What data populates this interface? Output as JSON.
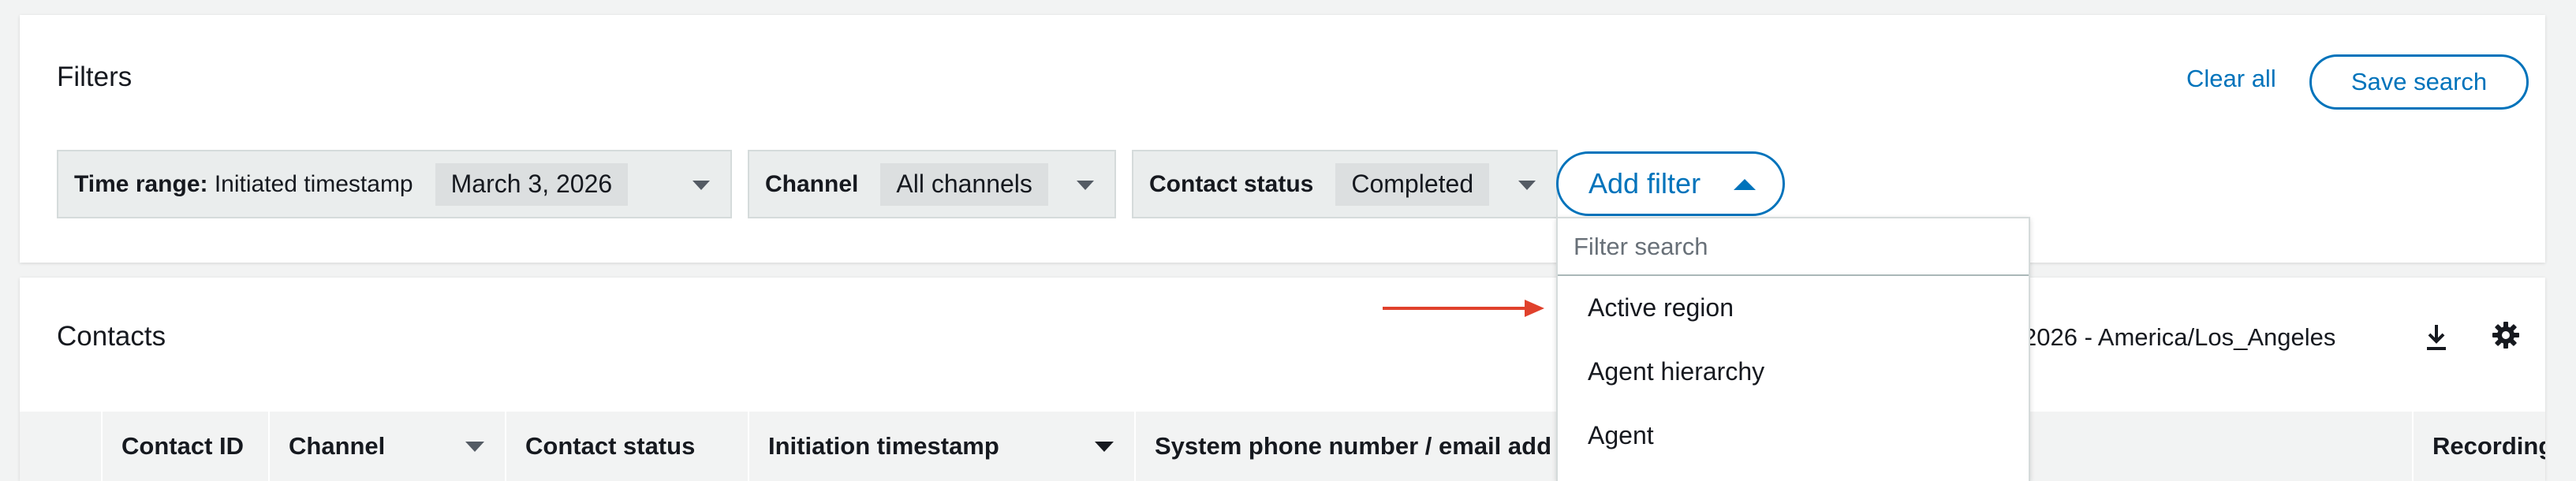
{
  "filters": {
    "title": "Filters",
    "clear_all": "Clear all",
    "save_search": "Save search",
    "chips": [
      {
        "label_bold": "Time range:",
        "label_rest": " Initiated timestamp",
        "value": "March 3, 2026"
      },
      {
        "label_bold": "Channel",
        "label_rest": "",
        "value": "All channels"
      },
      {
        "label_bold": "Contact status",
        "label_rest": "",
        "value": "Completed"
      }
    ],
    "add_filter": "Add filter"
  },
  "dropdown": {
    "search_placeholder": "Filter search",
    "items": [
      "Active region",
      "Agent hierarchy",
      "Agent"
    ]
  },
  "contacts": {
    "title": "Contacts",
    "timezone": "2026 - America/Los_Angeles",
    "columns": [
      "Contact ID",
      "Channel",
      "Contact status",
      "Initiation timestamp",
      "System phone number / email add",
      "Recording/"
    ]
  },
  "colors": {
    "accent": "#0073bb",
    "annotation_arrow": "#e0412c"
  },
  "icons": {
    "download": "download-icon",
    "settings": "gear-icon"
  }
}
